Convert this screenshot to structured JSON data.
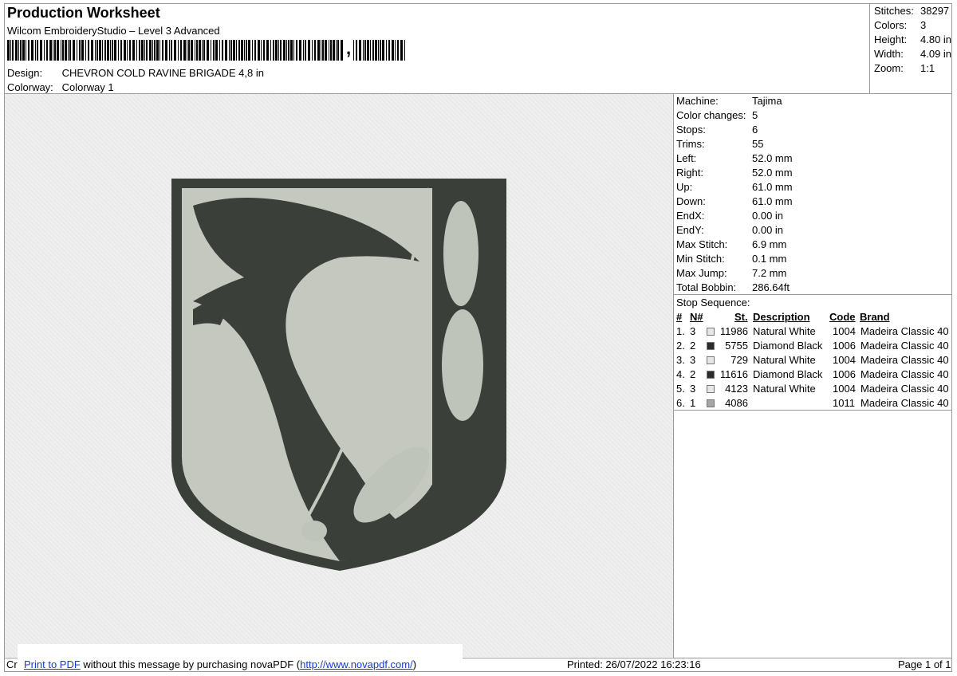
{
  "header": {
    "title": "Production Worksheet",
    "software": "Wilcom EmbroideryStudio – Level 3 Advanced",
    "barcode_suffix": ","
  },
  "design": {
    "design_label": "Design:",
    "design_name": "CHEVRON COLD RAVINE BRIGADE 4,8 in",
    "colorway_label": "Colorway:",
    "colorway_name": "Colorway 1"
  },
  "stats": [
    {
      "label": "Stitches:",
      "value": "38297"
    },
    {
      "label": "Colors:",
      "value": "3"
    },
    {
      "label": "Height:",
      "value": "4.80 in"
    },
    {
      "label": "Width:",
      "value": "4.09 in"
    },
    {
      "label": "Zoom:",
      "value": "1:1"
    }
  ],
  "machine": [
    {
      "label": "Machine:",
      "value": "Tajima"
    },
    {
      "label": "Color changes:",
      "value": "5"
    },
    {
      "label": "Stops:",
      "value": "6"
    },
    {
      "label": "Trims:",
      "value": "55"
    },
    {
      "label": "Left:",
      "value": "52.0 mm"
    },
    {
      "label": "Right:",
      "value": "52.0 mm"
    },
    {
      "label": "Up:",
      "value": "61.0 mm"
    },
    {
      "label": "Down:",
      "value": "61.0 mm"
    },
    {
      "label": "EndX:",
      "value": "0.00 in"
    },
    {
      "label": "EndY:",
      "value": "0.00 in"
    },
    {
      "label": "Max Stitch:",
      "value": "6.9 mm"
    },
    {
      "label": "Min Stitch:",
      "value": "0.1 mm"
    },
    {
      "label": "Max Jump:",
      "value": "7.2 mm"
    },
    {
      "label": "Total Bobbin:",
      "value": "286.64ft"
    }
  ],
  "sequence": {
    "title": "Stop Sequence:",
    "headers": {
      "num": "#",
      "needle": "N#",
      "stitches": "St.",
      "description": "Description",
      "code": "Code",
      "brand": "Brand"
    },
    "rows": [
      {
        "num": "1.",
        "needle": "3",
        "color": "#e6e6e6",
        "stitches": "11986",
        "description": "Natural White",
        "code": "1004",
        "brand": "Madeira Classic 40"
      },
      {
        "num": "2.",
        "needle": "2",
        "color": "#2b2b2b",
        "stitches": "5755",
        "description": "Diamond Black",
        "code": "1006",
        "brand": "Madeira Classic 40"
      },
      {
        "num": "3.",
        "needle": "3",
        "color": "#e6e6e6",
        "stitches": "729",
        "description": "Natural White",
        "code": "1004",
        "brand": "Madeira Classic 40"
      },
      {
        "num": "4.",
        "needle": "2",
        "color": "#2b2b2b",
        "stitches": "11616",
        "description": "Diamond Black",
        "code": "1006",
        "brand": "Madeira Classic 40"
      },
      {
        "num": "5.",
        "needle": "3",
        "color": "#e6e6e6",
        "stitches": "4123",
        "description": "Natural White",
        "code": "1004",
        "brand": "Madeira Classic 40"
      },
      {
        "num": "6.",
        "needle": "1",
        "color": "#a6a6a6",
        "stitches": "4086",
        "description": "",
        "code": "1011",
        "brand": "Madeira Classic 40"
      }
    ]
  },
  "footer": {
    "left_fragment": "Cr",
    "promo_link": "Print to PDF",
    "promo_text": " without this message by purchasing novaPDF (",
    "promo_url": "http://www.novapdf.com/",
    "promo_close": ")",
    "printed": "Printed: 26/07/2022 16:23:16",
    "page": "Page 1 of 1"
  },
  "colors": {
    "thread_dark": "#3b3f3a",
    "thread_light": "#bfc4bb",
    "canvas": "#efefef",
    "link": "#1b38d4"
  }
}
